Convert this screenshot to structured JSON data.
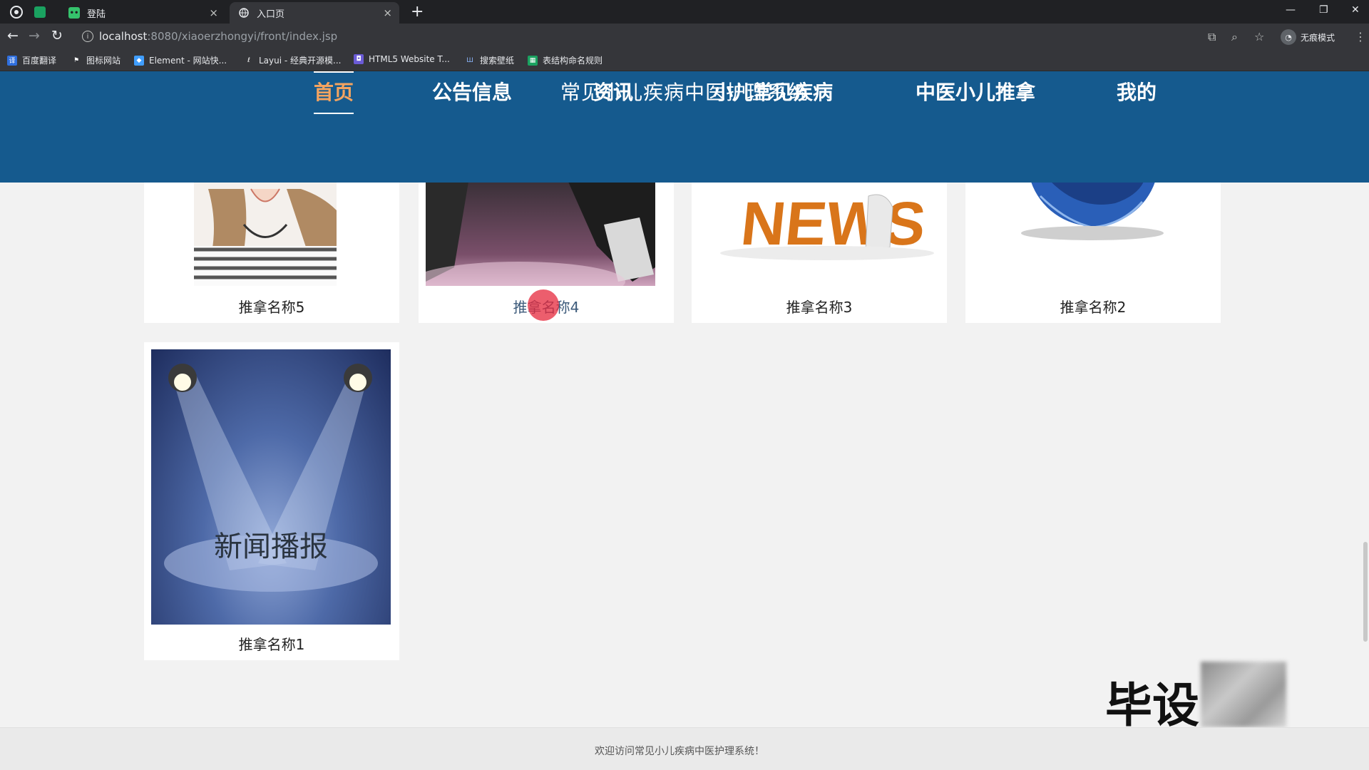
{
  "browser": {
    "tabs": [
      {
        "title": "登陆",
        "active": false
      },
      {
        "title": "入口页",
        "active": true
      }
    ],
    "url_host": "localhost",
    "url_path": ":8080/xiaoerzhongyi/front/index.jsp",
    "incognito_label": "无痕模式",
    "bookmarks": [
      "百度翻译",
      "图标网站",
      "Element - 网站快...",
      "Layui - 经典开源模...",
      "HTML5 Website T...",
      "搜索壁纸",
      "表结构命名规则"
    ]
  },
  "site": {
    "title": "常见小儿疾病中医护理系统",
    "nav": [
      "首页",
      "公告信息",
      "资讯",
      "小儿常见疾病",
      "中医小儿推拿",
      "我的"
    ],
    "active_nav": "首页",
    "active_color": "#f4a460",
    "header_color": "#155a8e"
  },
  "cards": [
    {
      "name": "推拿名称5"
    },
    {
      "name": "推拿名称4"
    },
    {
      "name": "推拿名称3"
    },
    {
      "name": "推拿名称2"
    },
    {
      "name": "推拿名称1",
      "image_caption": "新闻播报"
    }
  ],
  "card_images": {
    "news_text": "NEWS"
  },
  "footer": {
    "text": "欢迎访问常见小儿疾病中医护理系统！"
  },
  "watermark": {
    "text": "毕设"
  }
}
